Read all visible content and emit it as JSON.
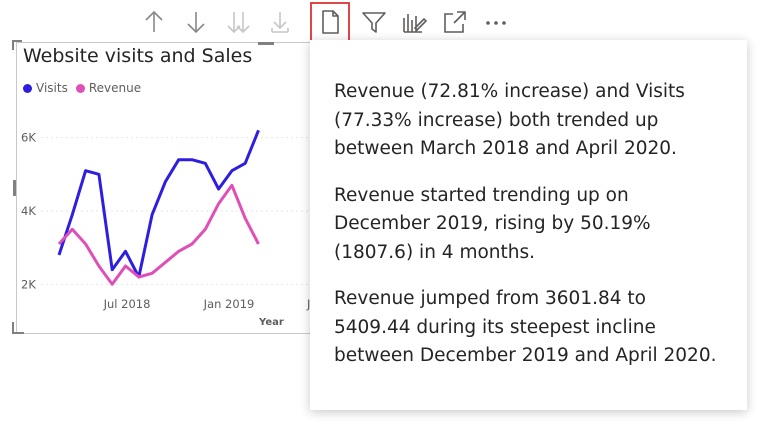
{
  "toolbar": {
    "icons": [
      "sort-ascending-icon",
      "sort-descending-icon",
      "expand-all-down-icon",
      "drill-down-icon",
      "insights-icon",
      "filter-icon",
      "drill-mode-icon",
      "focus-mode-icon",
      "more-options-icon"
    ],
    "highlight_color": "#e04646"
  },
  "visual": {
    "title": "Website visits and Sales",
    "legend": [
      {
        "name": "Visits",
        "color": "#2e1fe0"
      },
      {
        "name": "Revenue",
        "color": "#e04fb8"
      }
    ]
  },
  "chart_data": {
    "type": "line",
    "title": "Website visits and Sales",
    "xlabel": "Year",
    "ylabel": "",
    "x": [
      "2018-03",
      "2018-04",
      "2018-05",
      "2018-06",
      "2018-07",
      "2018-08",
      "2018-09",
      "2018-10",
      "2018-11",
      "2018-12",
      "2019-01",
      "2019-02",
      "2019-03",
      "2019-04",
      "2019-05",
      "2019-06",
      "2019-07",
      "2019-08",
      "2019-09",
      "2019-10"
    ],
    "x_ticks": [
      "Jul 2018",
      "Jan 2019",
      "J"
    ],
    "y_ticks": [
      "2K",
      "4K",
      "6K"
    ],
    "ylim": [
      1000,
      7000
    ],
    "series": [
      {
        "name": "Visits",
        "color": "#2e1fe0",
        "values": [
          2800,
          3900,
          5100,
          5000,
          2400,
          2900,
          2200,
          3900,
          4800,
          5400,
          5400,
          5300,
          4600,
          5100,
          5300,
          6200
        ]
      },
      {
        "name": "Revenue",
        "color": "#e04fb8",
        "values": [
          3100,
          3500,
          3100,
          2500,
          2000,
          2500,
          2200,
          2300,
          2600,
          2900,
          3100,
          3500,
          4200,
          4700,
          3800,
          3100
        ]
      }
    ],
    "grid": true,
    "legend_position": "top-left"
  },
  "insights": [
    "Revenue (72.81% increase) and Visits (77.33% increase) both trended up between March 2018 and April 2020.",
    "Revenue started trending up on December 2019, rising by 50.19% (1807.6) in 4 months.",
    "Revenue jumped from 3601.84 to 5409.44 during its steepest incline between December 2019 and April 2020."
  ]
}
